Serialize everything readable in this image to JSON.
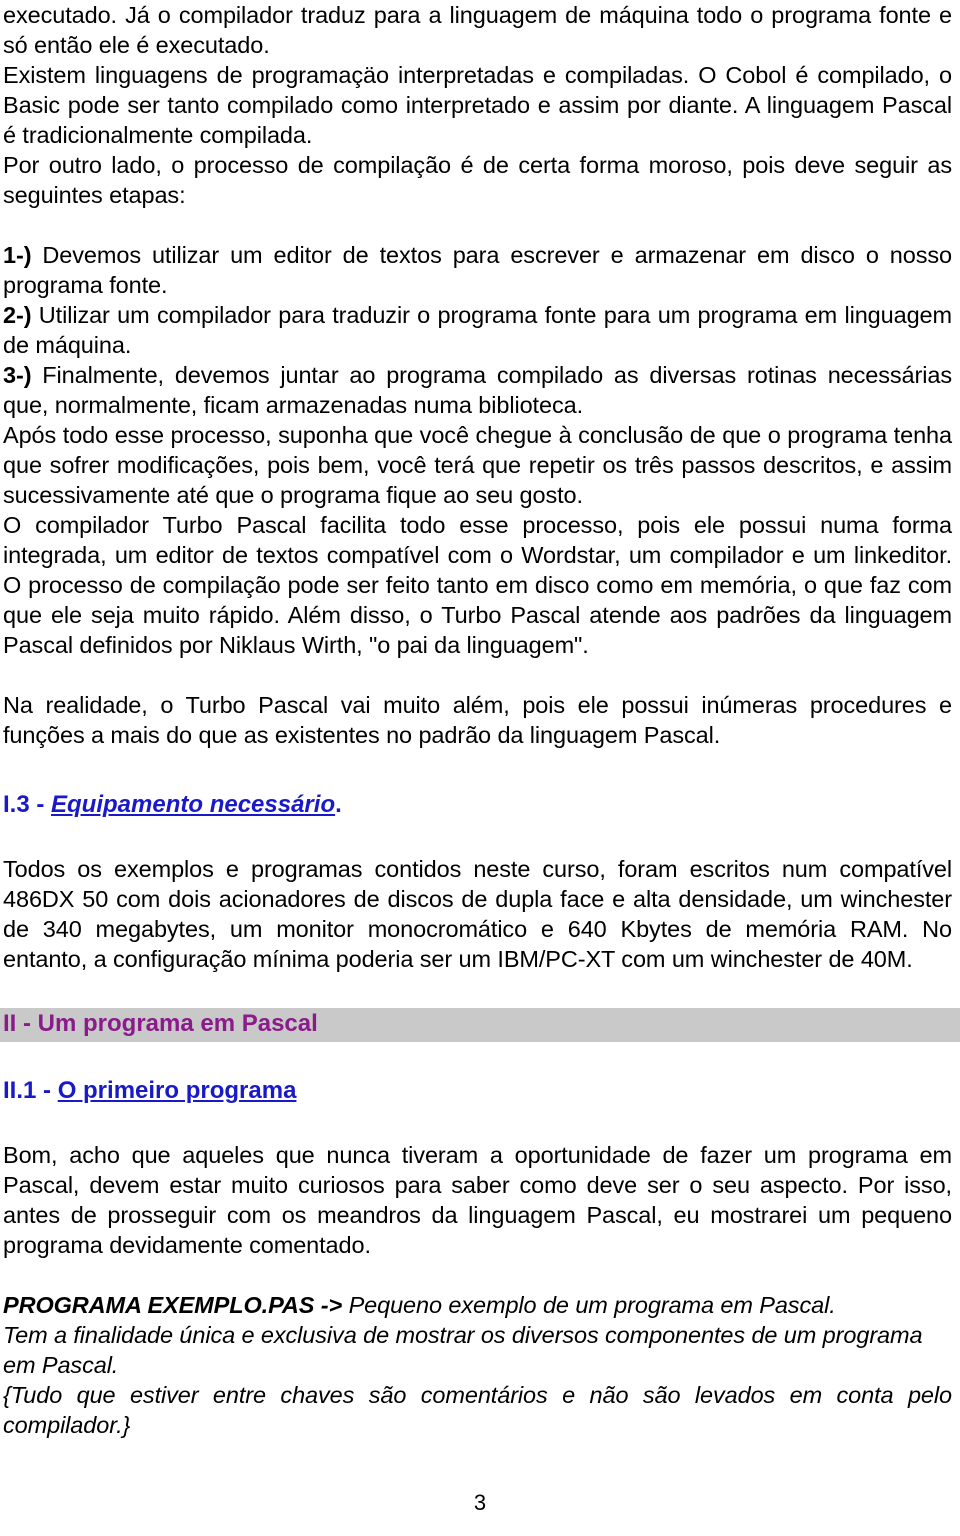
{
  "document": {
    "page_number": "3",
    "colors": {
      "text": "#000000",
      "link_blue": "#1a19c8",
      "chapter_purple": "#8b1a8b",
      "band_gray": "#c9c9c9",
      "background": "#ffffff"
    }
  },
  "body": {
    "p1": "executado. Já o compilador traduz para a linguagem de máquina todo o programa fonte e só então ele é executado.",
    "p2": "Existem linguagens de programaçäo interpretadas e compiladas. O Cobol é compilado, o Basic pode ser tanto compilado como interpretado e assim por diante. A linguagem Pascal é tradicionalmente compilada.",
    "p3": "Por outro lado, o processo de compilação é de certa forma moroso, pois deve seguir as seguintes etapas:",
    "step1_marker": "1-)",
    "step1_text": " Devemos utilizar um editor de textos para escrever e armazenar em disco o nosso programa fonte.",
    "step2_marker": "2-)",
    "step2_text": " Utilizar um compilador para traduzir o programa fonte para um programa em linguagem de máquina.",
    "step3_marker": "3-)",
    "step3_text": " Finalmente, devemos juntar ao programa compilado as diversas rotinas necessárias que, normalmente, ficam armazenadas numa biblioteca.",
    "p4": "Após todo esse processo, suponha que você chegue à conclusão de que o programa tenha que sofrer modificações, pois bem, você terá que repetir os três passos descritos, e assim sucessivamente até que o programa fique ao seu gosto.",
    "p5": "O compilador Turbo Pascal facilita todo esse processo, pois ele possui numa forma integrada, um editor de textos compatível com o Wordstar, um compilador e um linkeditor. O processo de compilação pode ser feito tanto em disco como em memória, o que faz com que ele seja muito rápido. Além disso, o Turbo Pascal atende aos padrões da linguagem Pascal definidos por Niklaus Wirth, \"o pai da linguagem\".",
    "p6": "Na realidade, o Turbo Pascal vai muito além, pois ele possui inúmeras procedures e funções a mais do que as existentes no padrão da linguagem Pascal.",
    "p7": "Todos os exemplos e programas contidos neste curso, foram escritos num compatível 486DX 50 com dois acionadores de discos de dupla face e alta densidade, um winchester de 340 megabytes, um monitor monocromático e 640 Kbytes de memória RAM. No entanto, a configuração mínima poderia ser um IBM/PC-XT com um winchester de 40M.",
    "p8": "Bom, acho que aqueles que nunca tiveram a oportunidade de fazer um programa em Pascal, devem estar muito curiosos para saber como deve ser o seu aspecto. Por isso, antes de prosseguir com os meandros da linguagem Pascal, eu mostrarei um pequeno programa devidamente comentado."
  },
  "headings": {
    "section_i3_number": "I.3 - ",
    "section_i3_title": "Equipamento necessário",
    "section_i3_tail": ".",
    "chapter_ii": "II - Um programa em Pascal",
    "section_ii1_number": "II.1 - ",
    "section_ii1_title": "O primeiro programa"
  },
  "program_block": {
    "title_bold": "PROGRAMA EXEMPLO.PAS ->",
    "title_rest": "  Pequeno exemplo de um programa em Pascal.",
    "line2": "Tem a finalidade  única e  exclusiva de mostrar os diversos componentes de um programa em Pascal.",
    "line3": "{Tudo que estiver entre chaves são comentários e não são levados em conta pelo compilador.}"
  }
}
